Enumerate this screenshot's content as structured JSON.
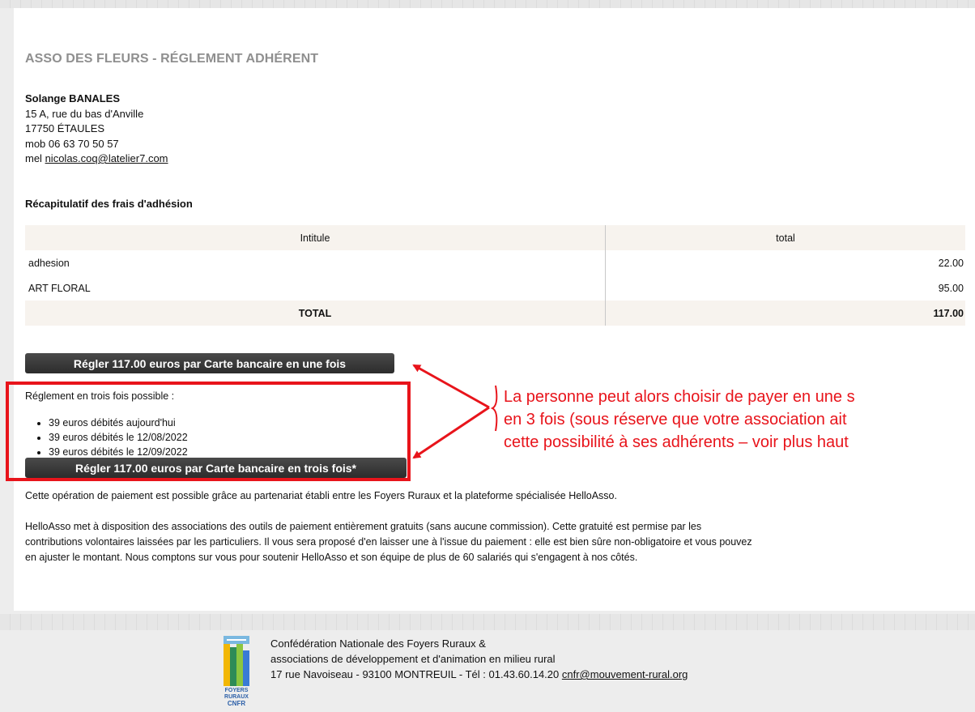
{
  "header": {
    "title": "ASSO DES FLEURS - RÉGLEMENT ADHÉRENT"
  },
  "contact": {
    "name": "Solange BANALES",
    "address_line1": "15 A, rue du bas d'Anville",
    "address_line2": "17750 ÉTAULES",
    "mobile": "mob 06 63 70 50 57",
    "email_prefix": "mel",
    "email": "nicolas.coq@latelier7.com"
  },
  "recap_title": "Récapitulatif des frais d'adhésion",
  "fees_table": {
    "headers": [
      "Intitule",
      "total"
    ],
    "rows": [
      {
        "label": "adhesion",
        "total": "22.00"
      },
      {
        "label": "ART FLORAL",
        "total": "95.00"
      }
    ],
    "total_label": "TOTAL",
    "total_value": "117.00"
  },
  "payment": {
    "button_one_label": "Régler 117.00 euros par Carte bancaire en une fois",
    "installments_title": "Réglement en trois fois possible :",
    "installments": [
      "39 euros débités aujourd'hui",
      "39 euros débités le 12/08/2022",
      "39 euros débités le 12/09/2022"
    ],
    "button_three_label": "Régler 117.00 euros par Carte bancaire en trois fois*"
  },
  "annotation": {
    "line1": "La personne peut alors choisir de payer en une s",
    "line2": "en 3 fois (sous réserve que votre association ait",
    "line3": "cette possibilité à ses adhérents – voir plus haut",
    "color": "#e8141b"
  },
  "info": {
    "paragraph1": "Cette opération de paiement est possible grâce au partenariat établi entre les Foyers Ruraux et la plateforme spécialisée HelloAsso.",
    "paragraph2_line1": "HelloAsso met à disposition des associations des outils de paiement entièrement gratuits (sans aucune commission). Cette gratuité est permise par les",
    "paragraph2_line2": "contributions volontaires laissées par les particuliers. Il vous sera proposé d'en laisser une à l'issue du paiement : elle est bien sûre non-obligatoire et vous pouvez",
    "paragraph2_line3": "en ajuster le montant. Nous comptons sur vous pour soutenir HelloAsso et son équipe de plus de 60 salariés qui s'engagent à nos côtés."
  },
  "footer": {
    "line1": "Confédération Nationale des Foyers Ruraux &",
    "line2": "associations de développement et d'animation en milieu rural",
    "line3_prefix": "17 rue Navoiseau - 93100 MONTREUIL - Tél : 01.43.60.14.20",
    "email": "cnfr@mouvement-rural.org",
    "logo_text_1": "FOYERS",
    "logo_text_2": "RURAUX",
    "logo_text_3": "CNFR"
  }
}
